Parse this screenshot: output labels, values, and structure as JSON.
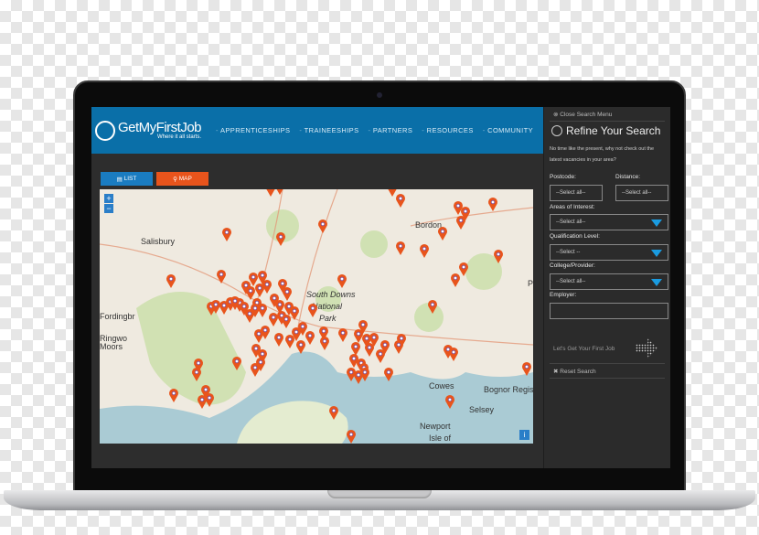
{
  "header": {
    "logo_text": "GetMyFirstJob",
    "tagline": "Where it all starts.",
    "nav": [
      "APPRENTICESHIPS",
      "TRAINEESHIPS",
      "PARTNERS",
      "RESOURCES",
      "COMMUNITY"
    ]
  },
  "view": {
    "list_label": "LIST",
    "map_label": "MAP",
    "list_icon": "list-icon",
    "map_icon": "map-pin-icon"
  },
  "map": {
    "zoom_in": "+",
    "zoom_out": "−",
    "info": "i",
    "labels": [
      "Salisbury",
      "Fordingbr",
      "Ringwo",
      "Moors",
      "South Downs",
      "National",
      "Park",
      "Bognor Regis",
      "Newport",
      "Isle of",
      "Cowes",
      "Bordon",
      "Petworth",
      "Selsey"
    ],
    "marker_color": "#e8541c",
    "sea_color": "#aacbd4"
  },
  "sidebar": {
    "close": "Close Search Menu",
    "title": "Refine Your Search",
    "intro1": "No time like the present, why not check out the",
    "intro2": "latest vacancies in your area?",
    "postcode_label": "Postcode:",
    "postcode_value": "--Select all--",
    "distance_label": "Distance:",
    "distance_value": "--Select all--",
    "areas_label": "Areas of Interest:",
    "areas_value": "--Select all--",
    "qual_label": "Qualification Level:",
    "qual_value": "--Select --",
    "college_label": "College/Provider:",
    "college_value": "--Select all--",
    "employer_label": "Employer:",
    "employer_value": "",
    "cta": "Let's Get Your First Job",
    "reset": "Reset Search"
  },
  "colors": {
    "header": "#0a6fa8",
    "list_button": "#1a7cc1",
    "map_button": "#e8541c",
    "dropdown_arrow": "#1a9be0"
  }
}
